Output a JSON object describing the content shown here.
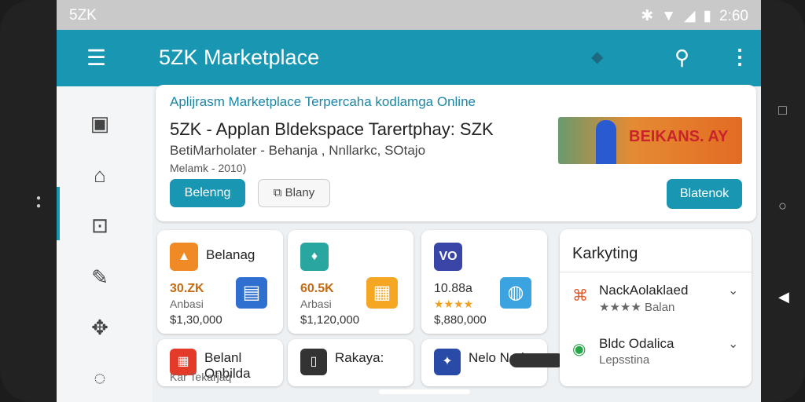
{
  "status": {
    "carrier": "5ZK",
    "time": "2:60"
  },
  "appbar": {
    "title": "5ZK Marketplace"
  },
  "hero": {
    "tagline": "Aplijrasm Marketplace Terpercaha kodlamga Online",
    "headline": "5ZK - Applan Bldekspace Tarertphay: SZK",
    "subline": "BetiMarholater - Behanja , Nnllarkc, SOtajo",
    "meta": "Melamk - 2010)",
    "primary_button": "Belenng",
    "secondary_button": "Blany",
    "banner_text": "BEIKANS. AY",
    "right_button": "Blatenok"
  },
  "products": [
    {
      "name": "Belanag",
      "price": "30.ZK",
      "sub": "Anbasi",
      "amount": "$1,30,000",
      "icon_color": "#f08a24"
    },
    {
      "name": "",
      "price": "60.5K",
      "sub": "Arbasi",
      "amount": "$1,120,000",
      "icon_color": "#2aa6a0"
    },
    {
      "name": "",
      "price": "10.88a",
      "stars": "★★★★",
      "amount": "$,880,000",
      "icon_color": "#3a45a8",
      "icon_label": "VO"
    }
  ],
  "products_row2": [
    {
      "name": "Belanl Onbilda",
      "sub": "Kar Tekarjaq"
    },
    {
      "name": "Rakaya:"
    },
    {
      "name": "Nelo Nad"
    }
  ],
  "sidebar_list": {
    "title": "Karkyting",
    "items": [
      {
        "title": "NackAolaklaed",
        "sub": "★★★★ Balan"
      },
      {
        "title": "Bldc Odalica",
        "sub": "Lepsstina"
      }
    ]
  },
  "colors": {
    "primary": "#1996b2",
    "price": "#c46b12",
    "star": "#f0a020"
  }
}
